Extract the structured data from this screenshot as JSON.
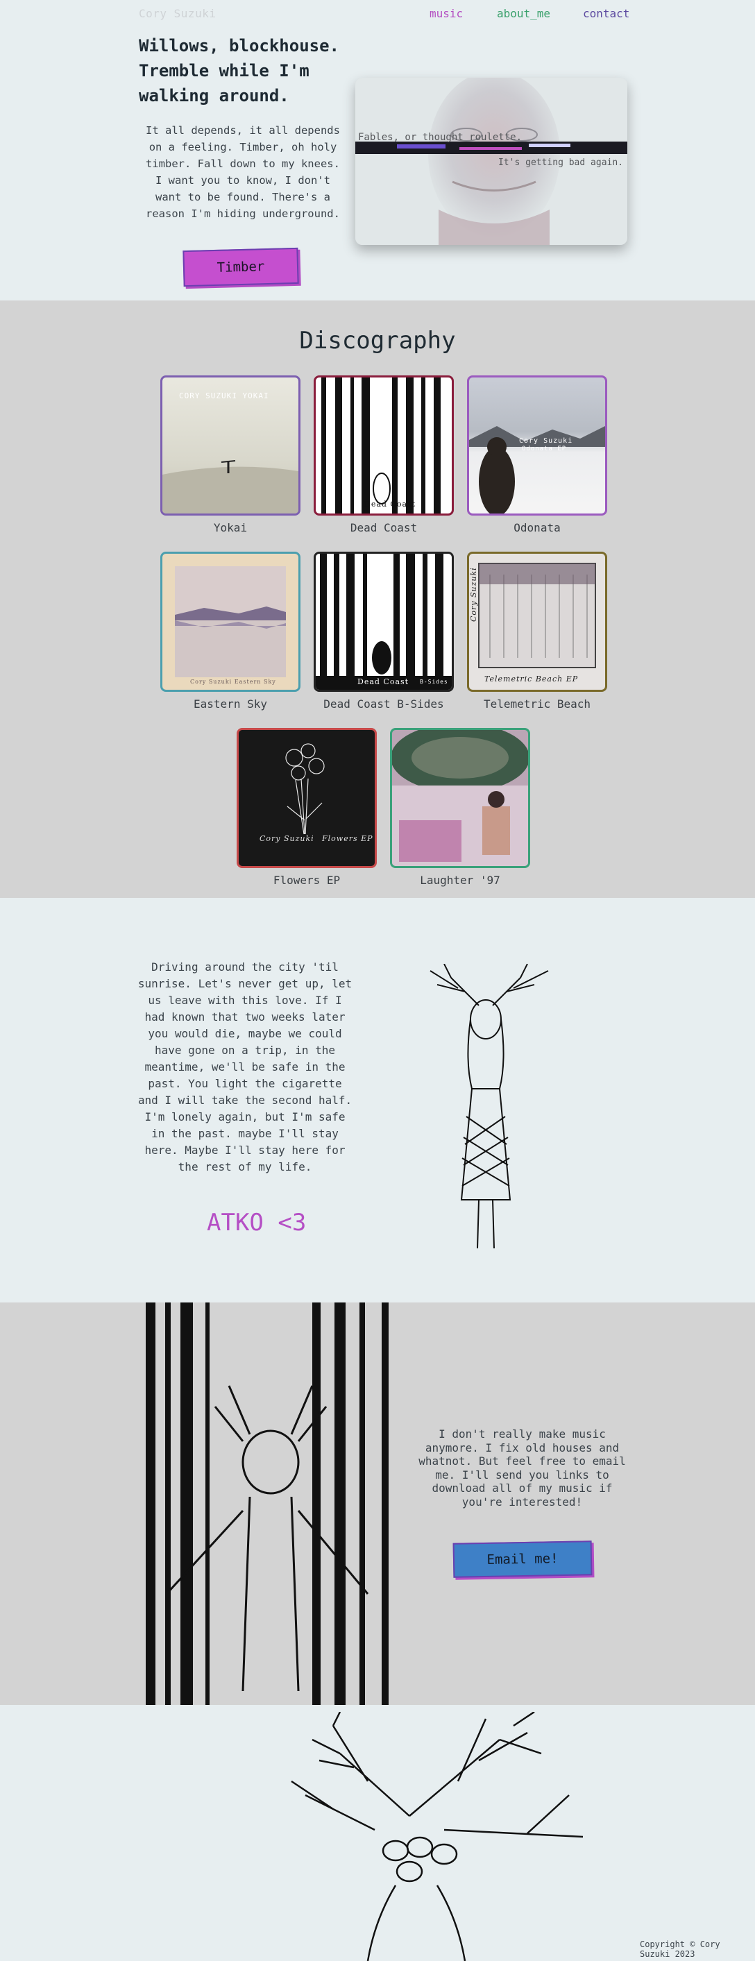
{
  "header": {
    "logo": "Cory Suzuki",
    "nav": [
      {
        "label": "music",
        "color": "#b44fc2"
      },
      {
        "label": "about_me",
        "color": "#3aa16c"
      },
      {
        "label": "contact",
        "color": "#5d4aa0"
      }
    ],
    "headline": "Willows, blockhouse. Tremble while I'm walking around.",
    "intro": "It all depends, it all depends on a feeling. Timber, oh holy timber. Fall down to my knees. I want you to know, I don't want to be found. There's a reason I'm hiding underground.",
    "button": "Timber",
    "hero_caption_1": "Fables, or thought roulette.",
    "hero_caption_2": "It's getting bad again."
  },
  "discography": {
    "title": "Discography",
    "albums": [
      {
        "name": "Yokai",
        "cover_text": "CORY SUZUKI YOKAI",
        "border": "#7c5fb0"
      },
      {
        "name": "Dead Coast",
        "cover_text": "Dead Coast",
        "border": "#8a1d3c"
      },
      {
        "name": "Odonata",
        "cover_text": "Cory Suzuki",
        "cover_text_2": "Odonata EP",
        "border": "#9b5bbf"
      },
      {
        "name": "Eastern Sky",
        "cover_text": "Cory Suzuki   Eastern Sky",
        "border": "#4b9fae"
      },
      {
        "name": "Dead Coast B-Sides",
        "cover_text": "Dead Coast",
        "cover_text_2": "B-Sides",
        "border": "#222222"
      },
      {
        "name": "Telemetric Beach",
        "cover_text": "Telemetric Beach EP",
        "cover_text_2": "Cory Suzuki",
        "border": "#7a6a2a"
      },
      {
        "name": "Flowers EP",
        "cover_text": "Cory Suzuki",
        "cover_text_2": "Flowers EP",
        "border": "#c74a4a"
      },
      {
        "name": "Laughter '97",
        "cover_text": "",
        "border": "#3aa17a"
      }
    ]
  },
  "atko": {
    "text": "Driving around the city 'til sunrise. Let's never get up, let us leave with this love. If I had known that two weeks later you would die, maybe we could have gone on a trip, in the meantime, we'll be safe in the past. You light the cigarette and I will take the second half. I'm lonely again, but I'm safe in the past. maybe I'll stay here. Maybe I'll stay here for the rest of my life.",
    "signature": "ATKO <3"
  },
  "email": {
    "text": "I don't really make music anymore. I fix old houses and whatnot. But feel free to email me. I'll send you links to download all of my music if you're interested!",
    "button": "Email me!"
  },
  "footer": {
    "copyright": "Copyright © Cory Suzuki 2023"
  },
  "colors": {
    "page_bg": "#e7eef0",
    "section_bg": "#d3d3d3",
    "accent_purple": "#c54fcf",
    "accent_blue": "#3e80c7"
  }
}
